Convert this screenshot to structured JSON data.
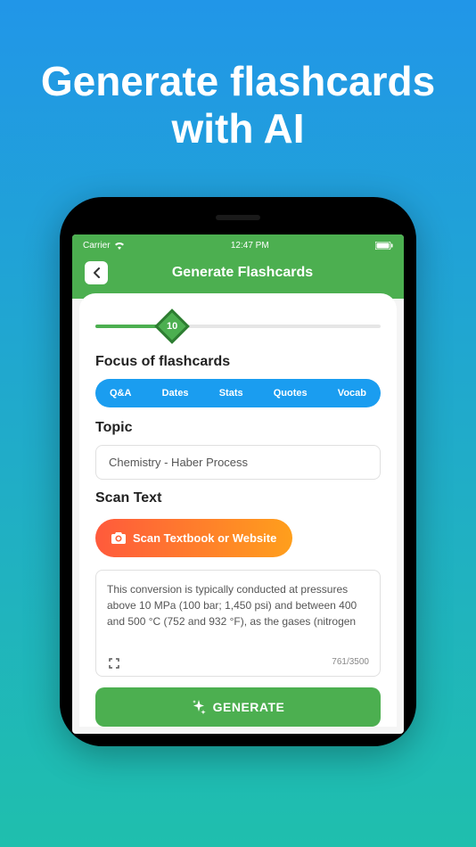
{
  "hero": {
    "title": "Generate flashcards with AI"
  },
  "statusBar": {
    "carrier": "Carrier",
    "time": "12:47 PM"
  },
  "header": {
    "title": "Generate Flashcards"
  },
  "slider": {
    "value": "10"
  },
  "sections": {
    "focus": "Focus of flashcards",
    "topic": "Topic",
    "scan": "Scan Text"
  },
  "focusPills": {
    "qa": "Q&A",
    "dates": "Dates",
    "stats": "Stats",
    "quotes": "Quotes",
    "vocab": "Vocab"
  },
  "topicInput": {
    "value": "Chemistry - Haber Process"
  },
  "scanButton": {
    "label": "Scan Textbook or Website"
  },
  "textArea": {
    "content": "This conversion is typically conducted at pressures\nabove 10 MPa (100 bar; 1,450 psi) and between 400\nand 500 °C (752 and 932 °F), as the gases (nitrogen",
    "count": "761/3500"
  },
  "generateButton": {
    "label": "GENERATE"
  }
}
